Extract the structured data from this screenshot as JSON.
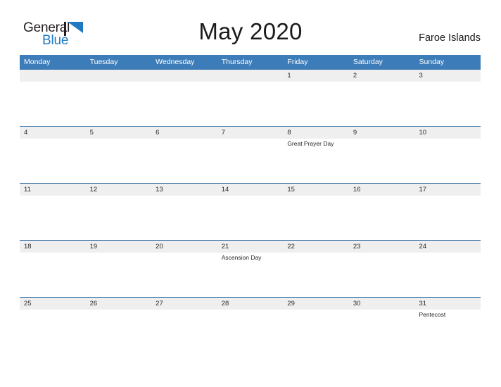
{
  "brand": {
    "word1": "General",
    "word2": "Blue",
    "mark": "flag-triangle-icon",
    "color_dark": "#231f20",
    "color_blue": "#1f7ac2"
  },
  "header": {
    "title": "May 2020",
    "country": "Faroe Islands"
  },
  "theme": {
    "header_blue": "#3c7cb8",
    "divider_blue": "#2e6da4",
    "band_gray": "#efefef",
    "text_dark": "#1b1b1b"
  },
  "calendar": {
    "month": "May",
    "year": "2020",
    "weekdays": [
      "Monday",
      "Tuesday",
      "Wednesday",
      "Thursday",
      "Friday",
      "Saturday",
      "Sunday"
    ],
    "weeks": [
      {
        "days": [
          {
            "date": "",
            "event": ""
          },
          {
            "date": "",
            "event": ""
          },
          {
            "date": "",
            "event": ""
          },
          {
            "date": "",
            "event": ""
          },
          {
            "date": "1",
            "event": ""
          },
          {
            "date": "2",
            "event": ""
          },
          {
            "date": "3",
            "event": ""
          }
        ]
      },
      {
        "days": [
          {
            "date": "4",
            "event": ""
          },
          {
            "date": "5",
            "event": ""
          },
          {
            "date": "6",
            "event": ""
          },
          {
            "date": "7",
            "event": ""
          },
          {
            "date": "8",
            "event": "Great Prayer Day"
          },
          {
            "date": "9",
            "event": ""
          },
          {
            "date": "10",
            "event": ""
          }
        ]
      },
      {
        "days": [
          {
            "date": "11",
            "event": ""
          },
          {
            "date": "12",
            "event": ""
          },
          {
            "date": "13",
            "event": ""
          },
          {
            "date": "14",
            "event": ""
          },
          {
            "date": "15",
            "event": ""
          },
          {
            "date": "16",
            "event": ""
          },
          {
            "date": "17",
            "event": ""
          }
        ]
      },
      {
        "days": [
          {
            "date": "18",
            "event": ""
          },
          {
            "date": "19",
            "event": ""
          },
          {
            "date": "20",
            "event": ""
          },
          {
            "date": "21",
            "event": "Ascension Day"
          },
          {
            "date": "22",
            "event": ""
          },
          {
            "date": "23",
            "event": ""
          },
          {
            "date": "24",
            "event": ""
          }
        ]
      },
      {
        "days": [
          {
            "date": "25",
            "event": ""
          },
          {
            "date": "26",
            "event": ""
          },
          {
            "date": "27",
            "event": ""
          },
          {
            "date": "28",
            "event": ""
          },
          {
            "date": "29",
            "event": ""
          },
          {
            "date": "30",
            "event": ""
          },
          {
            "date": "31",
            "event": "Pentecost"
          }
        ]
      }
    ]
  }
}
